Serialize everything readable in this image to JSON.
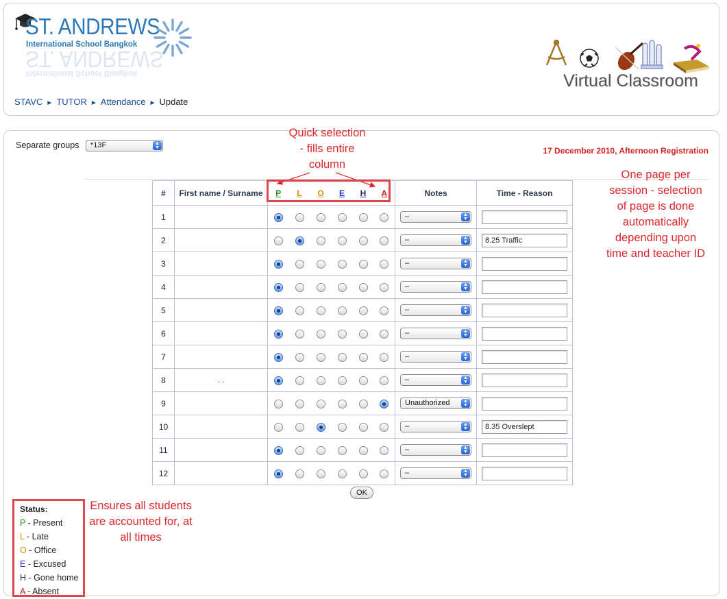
{
  "header": {
    "logo_name": "ST. ANDREWS",
    "logo_subtitle": "International School Bangkok",
    "vc_title": "Virtual Classroom",
    "breadcrumb": [
      {
        "label": "STAVC"
      },
      {
        "label": "TUTOR"
      },
      {
        "label": "Attendance"
      },
      {
        "label": "Update"
      }
    ],
    "breadcrumb_sep": "►"
  },
  "group": {
    "label": "Separate groups",
    "selected": "*13F"
  },
  "date_label": "17 December 2010, Afternoon Registration",
  "table": {
    "headers": {
      "num": "#",
      "name": "First name / Surname",
      "notes": "Notes",
      "time": "Time - Reason"
    },
    "status_codes": [
      {
        "code": "P",
        "color": "#2e8b1f"
      },
      {
        "code": "L",
        "color": "#e08e0b"
      },
      {
        "code": "O",
        "color": "#e08e0b"
      },
      {
        "code": "E",
        "color": "#2233cc"
      },
      {
        "code": "H",
        "color": "#1a2a6c"
      },
      {
        "code": "A",
        "color": "#d42323"
      }
    ],
    "rows": [
      {
        "num": "1",
        "name": "",
        "status": 0,
        "notes": "–",
        "time": ""
      },
      {
        "num": "2",
        "name": "",
        "status": 1,
        "notes": "–",
        "time": "8.25 Traffic"
      },
      {
        "num": "3",
        "name": "",
        "status": 0,
        "notes": "–",
        "time": ""
      },
      {
        "num": "4",
        "name": "",
        "status": 0,
        "notes": "–",
        "time": ""
      },
      {
        "num": "5",
        "name": "",
        "status": 0,
        "notes": "–",
        "time": ""
      },
      {
        "num": "6",
        "name": "",
        "status": 0,
        "notes": "–",
        "time": ""
      },
      {
        "num": "7",
        "name": "",
        "status": 0,
        "notes": "–",
        "time": ""
      },
      {
        "num": "8",
        "name": ".  .",
        "status": 0,
        "notes": "–",
        "time": ""
      },
      {
        "num": "9",
        "name": "",
        "status": 5,
        "notes": "Unauthorized",
        "time": ""
      },
      {
        "num": "10",
        "name": "",
        "status": 2,
        "notes": "–",
        "time": "8.35 Overslept"
      },
      {
        "num": "11",
        "name": "",
        "status": 0,
        "notes": "–",
        "time": ""
      },
      {
        "num": "12",
        "name": "",
        "status": 0,
        "notes": "–",
        "time": ""
      }
    ]
  },
  "ok_label": "OK",
  "status_legend": {
    "title": "Status:",
    "items": [
      {
        "code": "P",
        "text": " - Present",
        "color": "#2e8b1f"
      },
      {
        "code": "L",
        "text": " - Late",
        "color": "#e08e0b"
      },
      {
        "code": "O",
        "text": " - Office",
        "color": "#e08e0b"
      },
      {
        "code": "E",
        "text": " - Excused",
        "color": "#2233cc"
      },
      {
        "code": "H",
        "text": " - Gone home",
        "color": "#333333"
      },
      {
        "code": "A",
        "text": " - Absent",
        "color": "#d42323"
      }
    ]
  },
  "annotations": {
    "quick_selection": [
      "Quick selection",
      "- fills entire",
      "column"
    ],
    "one_page": [
      "One page per",
      "session - selection",
      "of page is done",
      "automatically",
      "depending upon",
      "time and teacher ID"
    ],
    "ensures": [
      "Ensures all students",
      "are accounted for, at",
      "all times"
    ]
  },
  "colors": {
    "brand_blue": "#2b79b8",
    "link_blue": "#1a4f9a",
    "annotation_red": "#e0262b",
    "date_red": "#d42323"
  }
}
